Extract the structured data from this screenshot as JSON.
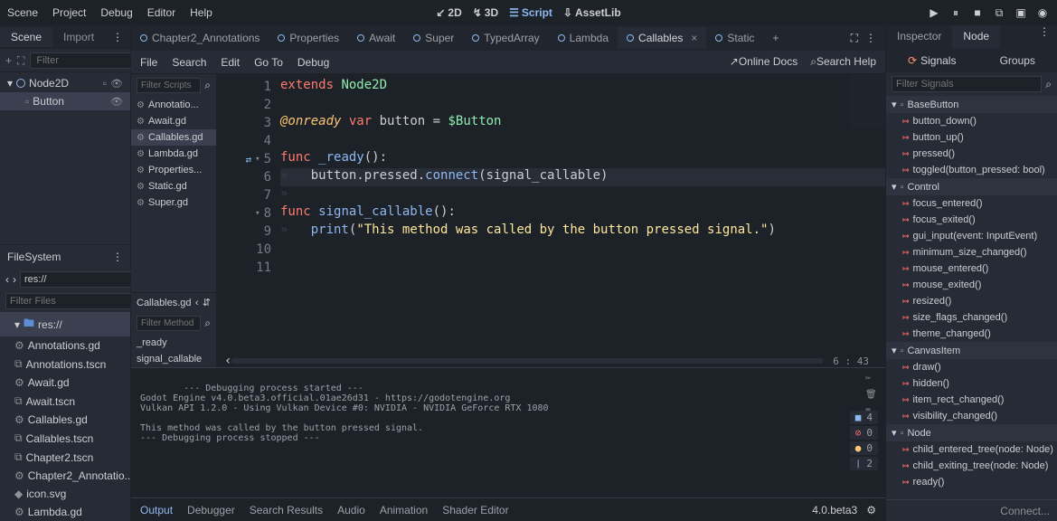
{
  "menubar": {
    "items": [
      "Scene",
      "Project",
      "Debug",
      "Editor",
      "Help"
    ]
  },
  "views": {
    "v2d": "2D",
    "v3d": "3D",
    "script": "Script",
    "assetlib": "AssetLib"
  },
  "left_tabs": {
    "scene": "Scene",
    "import": "Import"
  },
  "scene_toolbar": {
    "filter_placeholder": "Filter"
  },
  "scene_tree": {
    "root": "Node2D",
    "child": "Button"
  },
  "filesystem": {
    "title": "FileSystem",
    "path": "res://",
    "filter_placeholder": "Filter Files",
    "root": "res://",
    "files": [
      "Annotations.gd",
      "Annotations.tscn",
      "Await.gd",
      "Await.tscn",
      "Callables.gd",
      "Callables.tscn",
      "Chapter2.tscn",
      "Chapter2_Annotatio...",
      "icon.svg",
      "Lambda.gd"
    ]
  },
  "script_tabs": [
    "Chapter2_Annotations",
    "Properties",
    "Await",
    "Super",
    "TypedArray",
    "Lambda",
    "Callables",
    "Static"
  ],
  "script_tabs_active": 6,
  "script_menu": {
    "items": [
      "File",
      "Search",
      "Edit",
      "Go To",
      "Debug"
    ],
    "online_docs": "Online Docs",
    "search_help": "Search Help"
  },
  "script_sidebar": {
    "filter_scripts_placeholder": "Filter Scripts",
    "scripts": [
      "Annotatio...",
      "Await.gd",
      "Callables.gd",
      "Lambda.gd",
      "Properties...",
      "Static.gd",
      "Super.gd"
    ],
    "active_script": 2,
    "current": "Callables.gd",
    "filter_method_placeholder": "Filter Method",
    "methods": [
      "_ready",
      "signal_callable"
    ]
  },
  "code": {
    "lines": 11,
    "tokens": {
      "l1": {
        "kw": "extends",
        "type": "Node2D"
      },
      "l3": {
        "ann": "@onready",
        "kw": "var",
        "id": "button",
        "op": "=",
        "nd": "$Button"
      },
      "l5": {
        "kw": "func",
        "fn": "_ready",
        "paren": "():"
      },
      "l6": {
        "txt": "button.pressed.",
        "fn": "connect",
        "rest": "(signal_callable)"
      },
      "l8": {
        "kw": "func",
        "fn": "signal_callable",
        "paren": "():"
      },
      "l9": {
        "fn2": "print",
        "str": "\"This method was called by the button pressed signal.\"",
        "open": "(",
        "close": ")"
      }
    },
    "cursor": "6  :  43"
  },
  "output": {
    "text": "--- Debugging process started ---\nGodot Engine v4.0.beta3.official.01ae26d31 - https://godotengine.org\nVulkan API 1.2.0 - Using Vulkan Device #0: NVIDIA - NVIDIA GeForce RTX 1080\n\nThis method was called by the button pressed signal.\n--- Debugging process stopped ---",
    "counts": {
      "err": "4",
      "errsym": "0",
      "warn": "0",
      "info": "2"
    }
  },
  "bottom_tabs": [
    "Output",
    "Debugger",
    "Search Results",
    "Audio",
    "Animation",
    "Shader Editor"
  ],
  "version": "4.0.beta3",
  "inspector_tabs": {
    "inspector": "Inspector",
    "node": "Node"
  },
  "sg_tabs": {
    "signals": "Signals",
    "groups": "Groups"
  },
  "sig_filter_placeholder": "Filter Signals",
  "signals": [
    {
      "group": "BaseButton",
      "items": [
        "button_down()",
        "button_up()",
        "pressed()",
        "toggled(button_pressed: bool)"
      ]
    },
    {
      "group": "Control",
      "items": [
        "focus_entered()",
        "focus_exited()",
        "gui_input(event: InputEvent)",
        "minimum_size_changed()",
        "mouse_entered()",
        "mouse_exited()",
        "resized()",
        "size_flags_changed()",
        "theme_changed()"
      ]
    },
    {
      "group": "CanvasItem",
      "items": [
        "draw()",
        "hidden()",
        "item_rect_changed()",
        "visibility_changed()"
      ]
    },
    {
      "group": "Node",
      "items": [
        "child_entered_tree(node: Node)",
        "child_exiting_tree(node: Node)",
        "ready()"
      ]
    }
  ],
  "connect_label": "Connect..."
}
